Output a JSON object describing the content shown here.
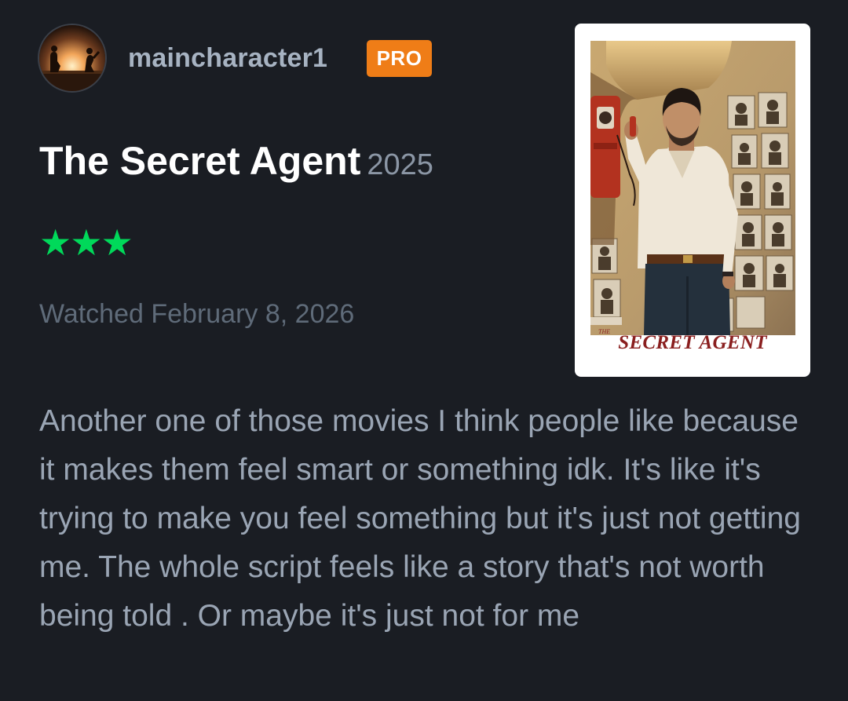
{
  "user": {
    "username": "maincharacter1",
    "badge": "PRO",
    "avatar_icon": "sunset-silhouette-avatar"
  },
  "film": {
    "title": "The Secret Agent",
    "year": "2025",
    "rating_stars": 3,
    "rating_text": "★★★",
    "poster": {
      "title_small": "THE",
      "title": "SECRET AGENT"
    }
  },
  "watched": {
    "text": "Watched February 8, 2026"
  },
  "review": {
    "text": "Another one of those movies I think people like because it makes them feel smart or something idk. It's like it's trying to make you feel something but it's just not getting me. The whole script feels like a story that's not worth being told . Or maybe it's just not for me"
  },
  "colors": {
    "background": "#1a1d23",
    "star": "#00d95a",
    "pro_badge": "#ef7d17",
    "poster_title": "#8a1f1f"
  }
}
